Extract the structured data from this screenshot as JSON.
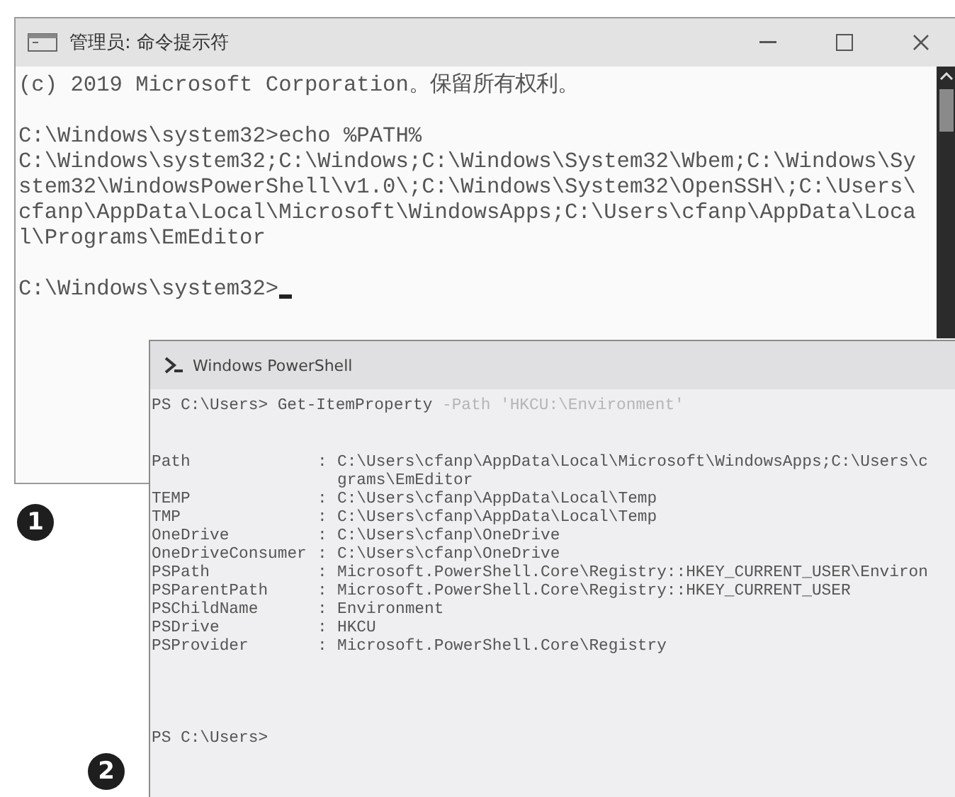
{
  "cmd_window": {
    "title": "管理员: 命令提示符",
    "blocks": [
      [
        "(c) 2019 Microsoft Corporation。保留所有权利。"
      ],
      [
        "C:\\Windows\\system32>echo %PATH%",
        "C:\\Windows\\system32;C:\\Windows;C:\\Windows\\System32\\Wbem;C:\\Windows\\Sy",
        "stem32\\WindowsPowerShell\\v1.0\\;C:\\Windows\\System32\\OpenSSH\\;C:\\Users\\",
        "cfanp\\AppData\\Local\\Microsoft\\WindowsApps;C:\\Users\\cfanp\\AppData\\Loca",
        "l\\Programs\\EmEditor"
      ],
      [
        "C:\\Windows\\system32>"
      ]
    ]
  },
  "powershell_window": {
    "title": "Windows PowerShell",
    "command": [
      {
        "kind": "prompt",
        "text": "PS C:\\Users>"
      },
      {
        "kind": "cmdlet",
        "text": "Get-ItemProperty"
      },
      {
        "kind": "parameter",
        "text": "-Path 'HKCU:\\Environment'"
      }
    ],
    "properties": [
      {
        "name": "Path",
        "value_lines": [
          "C:\\Users\\cfanp\\AppData\\Local\\Microsoft\\WindowsApps;C:\\Users\\c",
          "grams\\EmEditor"
        ]
      },
      {
        "name": "TEMP",
        "value_lines": [
          "C:\\Users\\cfanp\\AppData\\Local\\Temp"
        ]
      },
      {
        "name": "TMP",
        "value_lines": [
          "C:\\Users\\cfanp\\AppData\\Local\\Temp"
        ]
      },
      {
        "name": "OneDrive",
        "value_lines": [
          "C:\\Users\\cfanp\\OneDrive"
        ]
      },
      {
        "name": "OneDriveConsumer",
        "value_lines": [
          "C:\\Users\\cfanp\\OneDrive"
        ]
      },
      {
        "name": "PSPath",
        "value_lines": [
          "Microsoft.PowerShell.Core\\Registry::HKEY_CURRENT_USER\\Environ"
        ]
      },
      {
        "name": "PSParentPath",
        "value_lines": [
          "Microsoft.PowerShell.Core\\Registry::HKEY_CURRENT_USER"
        ]
      },
      {
        "name": "PSChildName",
        "value_lines": [
          "Environment"
        ]
      },
      {
        "name": "PSDrive",
        "value_lines": [
          "HKCU"
        ]
      },
      {
        "name": "PSProvider",
        "value_lines": [
          "Microsoft.PowerShell.Core\\Registry"
        ]
      }
    ],
    "separator": ":",
    "prompt": "PS C:\\Users>"
  },
  "callouts": [
    "1",
    "2"
  ]
}
